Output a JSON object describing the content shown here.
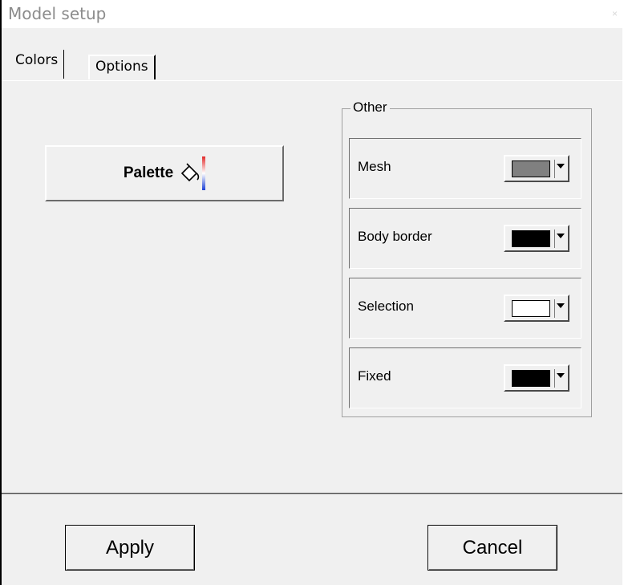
{
  "window": {
    "title": "Model setup",
    "close_glyph": "×"
  },
  "tabs": [
    {
      "label": "Colors",
      "active": true
    },
    {
      "label": "Options",
      "active": false
    }
  ],
  "palette_button": {
    "label": "Palette",
    "icon": "paint-bucket-icon"
  },
  "other_group": {
    "title": "Other",
    "rows": [
      {
        "label": "Mesh",
        "color": "#808080"
      },
      {
        "label": "Body border",
        "color": "#000000"
      },
      {
        "label": "Selection",
        "color": "#ffffff"
      },
      {
        "label": "Fixed",
        "color": "#000000"
      }
    ]
  },
  "footer": {
    "apply_label": "Apply",
    "cancel_label": "Cancel"
  }
}
